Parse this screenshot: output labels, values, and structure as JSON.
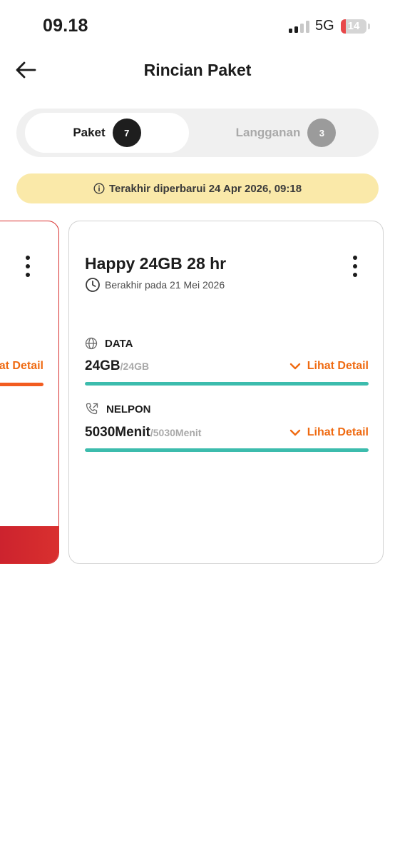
{
  "status_bar": {
    "time": "09.18",
    "network": "5G",
    "battery_level": "14",
    "signal_bars_active": 2,
    "signal_bars_total": 4
  },
  "header": {
    "title": "Rincian Paket",
    "back_icon": "arrow-left-icon"
  },
  "tabs": [
    {
      "label": "Paket",
      "count": "7",
      "active": true
    },
    {
      "label": "Langganan",
      "count": "3",
      "active": false
    }
  ],
  "banner": {
    "text": "Terakhir diperbarui 24 Apr 2026, 09:18",
    "icon": "info-icon"
  },
  "cards": {
    "previous": {
      "detail_link": "Lihat Detail",
      "accent_color": "#d9302f"
    },
    "current": {
      "name": "Happy 24GB 28 hr",
      "expiry": "Berakhir pada 21 Mei 2026",
      "quotas": [
        {
          "type": "DATA",
          "icon": "globe-icon",
          "remaining": "24GB",
          "total": "/24GB",
          "detail_label": "Lihat Detail",
          "fraction_remaining": 1.0
        },
        {
          "type": "NELPON",
          "icon": "phone-call-icon",
          "remaining": "5030Menit",
          "total": "/5030Menit",
          "detail_label": "Lihat Detail",
          "fraction_remaining": 1.0
        }
      ]
    }
  },
  "colors": {
    "accent_orange": "#ef6a11",
    "progress_teal": "#3cbcad",
    "banner_yellow": "#fae9a9",
    "brand_red": "#d9302f"
  }
}
